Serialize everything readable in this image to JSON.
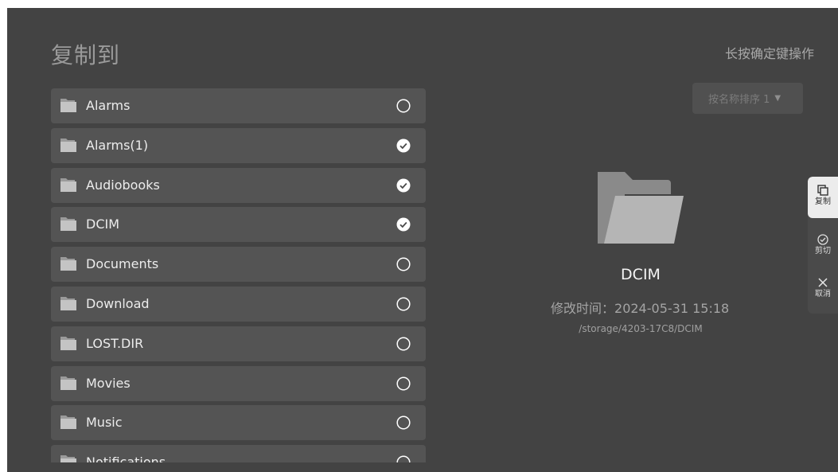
{
  "header": {
    "title": "复制到",
    "hint": "长按确定键操作"
  },
  "sort": {
    "label": "按名称排序 1"
  },
  "folders": [
    {
      "name": "Alarms",
      "checked": false
    },
    {
      "name": "Alarms(1)",
      "checked": true
    },
    {
      "name": "Audiobooks",
      "checked": true
    },
    {
      "name": "DCIM",
      "checked": true
    },
    {
      "name": "Documents",
      "checked": false
    },
    {
      "name": "Download",
      "checked": false
    },
    {
      "name": "LOST.DIR",
      "checked": false
    },
    {
      "name": "Movies",
      "checked": false
    },
    {
      "name": "Music",
      "checked": false
    },
    {
      "name": "Notifications",
      "checked": false
    }
  ],
  "preview": {
    "name": "DCIM",
    "modified_label": "修改时间：",
    "modified_value": "2024-05-31 15:18",
    "path": "/storage/4203-17C8/DCIM"
  },
  "side_menu": [
    {
      "label": "复制",
      "icon": "copy-icon",
      "active": true
    },
    {
      "label": "剪切",
      "icon": "check-circle-icon",
      "active": false
    },
    {
      "label": "取消",
      "icon": "close-icon",
      "active": false
    }
  ]
}
